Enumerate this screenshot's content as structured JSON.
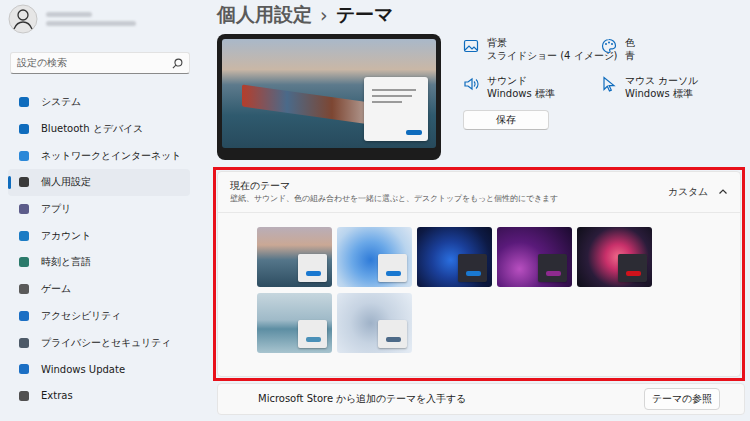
{
  "breadcrumb": {
    "parent": "個人用設定",
    "separator": "›",
    "current": "テーマ"
  },
  "search": {
    "placeholder": "設定の検索"
  },
  "sidebar": {
    "items": [
      {
        "label": "システム",
        "selected": false
      },
      {
        "label": "Bluetooth とデバイス",
        "selected": false
      },
      {
        "label": "ネットワークとインターネット",
        "selected": false
      },
      {
        "label": "個人用設定",
        "selected": true
      },
      {
        "label": "アプリ",
        "selected": false
      },
      {
        "label": "アカウント",
        "selected": false
      },
      {
        "label": "時刻と言語",
        "selected": false
      },
      {
        "label": "ゲーム",
        "selected": false
      },
      {
        "label": "アクセシビリティ",
        "selected": false
      },
      {
        "label": "プライバシーとセキュリティ",
        "selected": false
      },
      {
        "label": "Windows Update",
        "selected": false
      },
      {
        "label": "Extras",
        "selected": false
      }
    ]
  },
  "theme_settings": [
    {
      "label": "背景",
      "value": "スライドショー (4 イメージ)"
    },
    {
      "label": "色",
      "value": "青"
    },
    {
      "label": "サウンド",
      "value": "Windows 標準"
    },
    {
      "label": "マウス カーソル",
      "value": "Windows 標準"
    }
  ],
  "save_button": "保存",
  "current_theme": {
    "title": "現在のテーマ",
    "subtitle": "壁紙、サウンド、色の組み合わせを一緒に選ぶと、デスクトップをもっと個性的にできます",
    "value": "カスタム",
    "expanded": true,
    "themes": [
      {
        "color": "#1a78d0",
        "dark": false
      },
      {
        "color": "#1a78d0",
        "dark": false
      },
      {
        "color": "#1a78d0",
        "dark": true
      },
      {
        "color": "#8e2a8e",
        "dark": true
      },
      {
        "color": "#d0121b",
        "dark": true
      },
      {
        "color": "#4a90b8",
        "dark": false
      },
      {
        "color": "#4d6a88",
        "dark": false
      }
    ]
  },
  "store": {
    "text": "Microsoft Store から追加のテーマを入手する",
    "button": "テーマの参照"
  }
}
